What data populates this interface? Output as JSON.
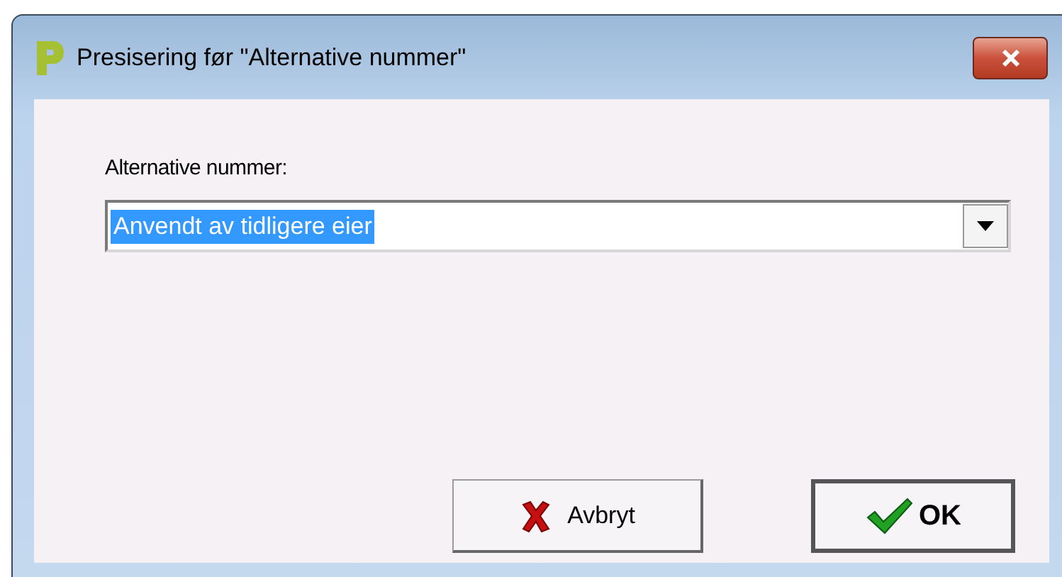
{
  "window": {
    "title": "Presisering før \"Alternative nummer\""
  },
  "field": {
    "label": "Alternative nummer:",
    "value": "Anvendt av tidligere eier",
    "value_highlighted": true
  },
  "buttons": [
    {
      "label": "Avbryt",
      "kind": "cancel",
      "default": false
    },
    {
      "label": "OK",
      "kind": "ok",
      "default": true
    }
  ]
}
